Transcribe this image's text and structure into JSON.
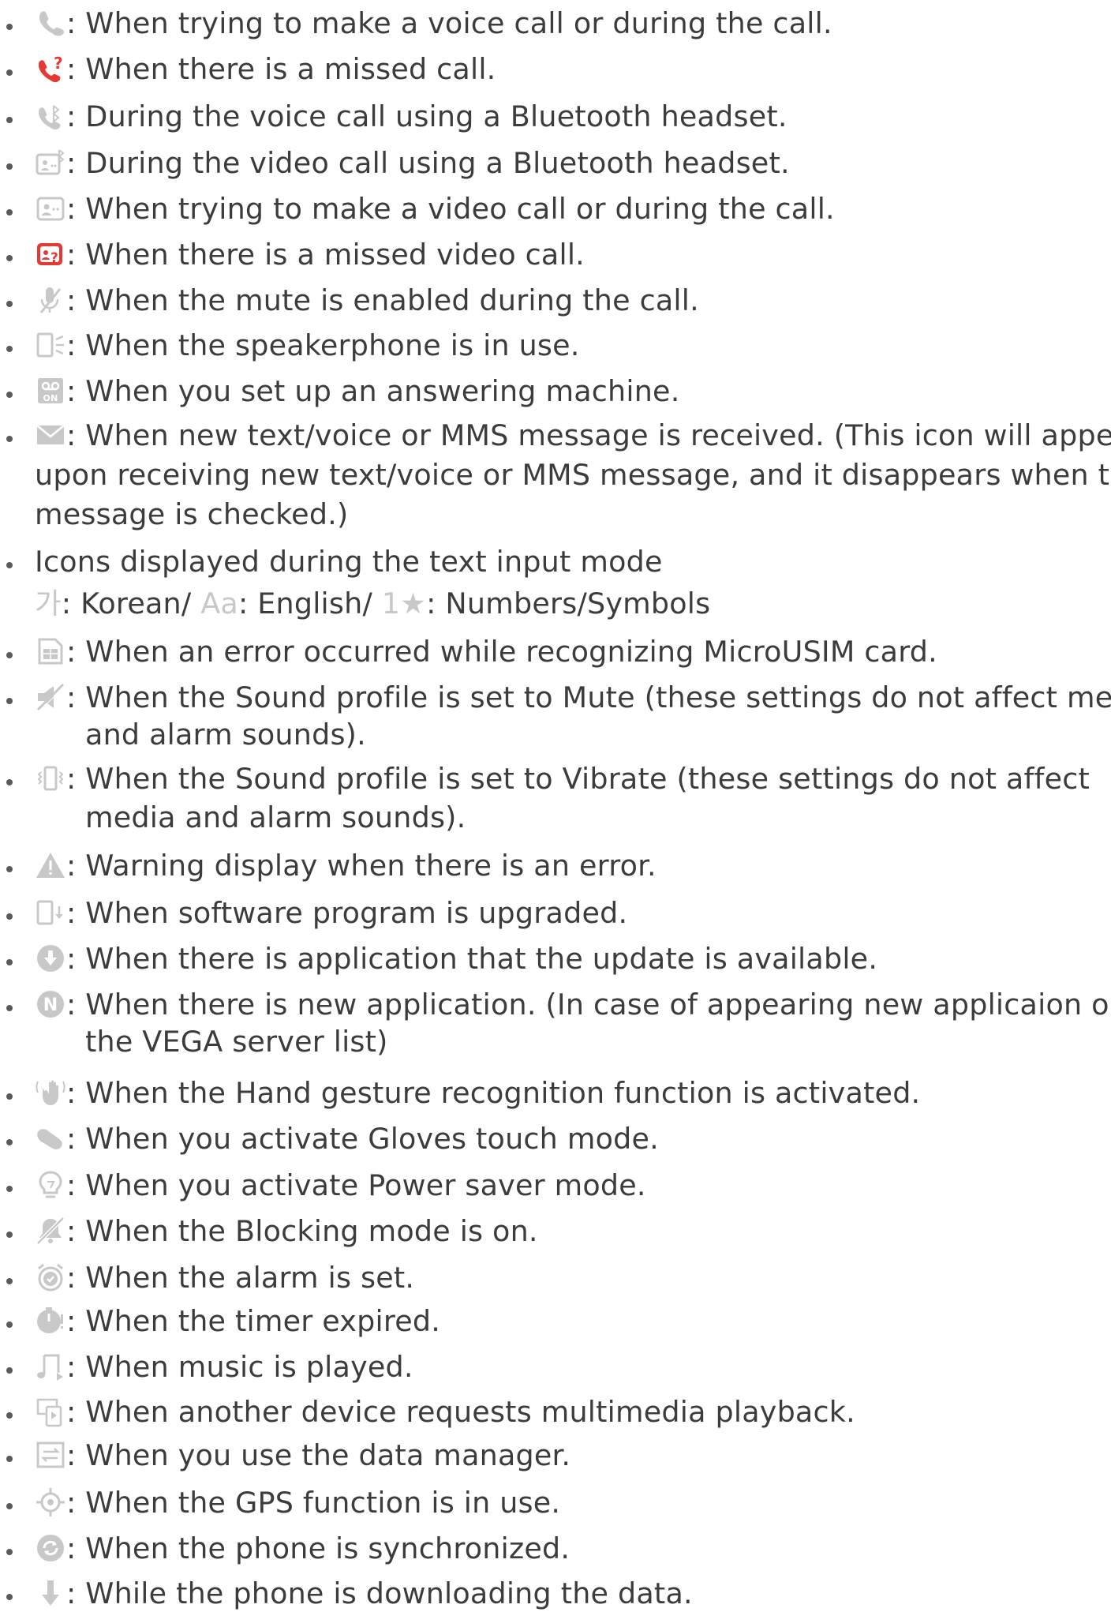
{
  "items": [
    {
      "icon": "voice-call-icon",
      "text": ": When trying to make a voice call or during the call."
    },
    {
      "icon": "missed-call-icon",
      "text": ": When there is a missed call."
    },
    {
      "icon": "bluetooth-voice-call-icon",
      "text": ": During the voice call using a Bluetooth headset."
    },
    {
      "icon": "bluetooth-video-call-icon",
      "text": ": During the video call using a Bluetooth headset."
    },
    {
      "icon": "video-call-icon",
      "text": ": When trying to make a video call or during the call."
    },
    {
      "icon": "missed-video-call-icon",
      "text": ": When there is a missed video call."
    },
    {
      "icon": "mute-icon",
      "text": ": When the mute is enabled during the call."
    },
    {
      "icon": "speakerphone-icon",
      "text": ": When the speakerphone is in use."
    },
    {
      "icon": "answering-machine-icon",
      "text": ": When you set up an answering machine."
    },
    {
      "icon": "message-icon",
      "lines": [
        ": When new text/voice or MMS message is received. (This icon will appear",
        "upon receiving new text/voice or MMS message, and it disappears when the",
        "message is checked.)"
      ]
    },
    {
      "text": "Icons displayed during the text input mode",
      "sub": {
        "korean_glyph": "가",
        "korean_label": ": Korean/ ",
        "english_glyph": "Aa",
        "english_label": ": English/ ",
        "numbers_glyph": "1★",
        "numbers_label": ": Numbers/Symbols"
      }
    },
    {
      "icon": "sim-error-icon",
      "text": ": When an error occurred while recognizing MicroUSIM card."
    },
    {
      "icon": "sound-mute-icon",
      "lines": [
        ": When the Sound profile is set to Mute (these settings do not affect media",
        "and alarm sounds)."
      ]
    },
    {
      "icon": "vibrate-icon",
      "lines": [
        ": When the Sound profile is set to Vibrate (these settings do not affect",
        "media and alarm sounds)."
      ]
    },
    {
      "icon": "warning-icon",
      "text": ": Warning display when there is an error."
    },
    {
      "icon": "software-upgrade-icon",
      "text": ": When software program is upgraded."
    },
    {
      "icon": "app-update-icon",
      "text": ": When there is application that the update is available."
    },
    {
      "icon": "new-app-icon",
      "lines": [
        ": When there is new application. (In case of appearing new applicaion on",
        "the VEGA server list)"
      ]
    },
    {
      "icon": "hand-gesture-icon",
      "text": ": When the Hand gesture recognition function is activated."
    },
    {
      "icon": "gloves-touch-icon",
      "text": ": When you activate Gloves touch mode."
    },
    {
      "icon": "power-saver-icon",
      "text": ": When you activate Power saver mode."
    },
    {
      "icon": "blocking-mode-icon",
      "text": ": When the Blocking mode is on."
    },
    {
      "icon": "alarm-icon",
      "text": ": When the alarm is set."
    },
    {
      "icon": "timer-expired-icon",
      "text": ": When the timer expired."
    },
    {
      "icon": "music-icon",
      "text": ": When music is played."
    },
    {
      "icon": "multimedia-request-icon",
      "text": ": When another device requests multimedia playback."
    },
    {
      "icon": "data-manager-icon",
      "text": ": When you use the data manager."
    },
    {
      "icon": "gps-icon",
      "text": ": When the GPS function is in use."
    },
    {
      "icon": "sync-icon",
      "text": ": When the phone is synchronized."
    },
    {
      "icon": "download-icon",
      "text": ": While the phone is downloading the data."
    }
  ],
  "colors": {
    "text": "#3c3c3c",
    "icon_gray": "#c8c8c8",
    "missed_red": "#e53935"
  }
}
